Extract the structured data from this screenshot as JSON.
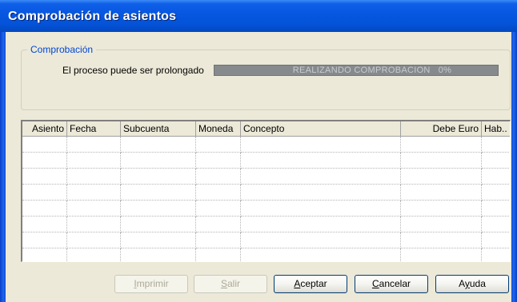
{
  "window": {
    "title": "Comprobación de asientos"
  },
  "group": {
    "legend": "Comprobación",
    "process_label": "El proceso puede ser prolongado",
    "progress_text": "REALIZANDO COMPROBACION   0%",
    "progress_percent": 0
  },
  "grid": {
    "columns": [
      "Asiento",
      "Fecha",
      "Subcuenta",
      "Moneda",
      "Concepto",
      "Debe Euro",
      "Hab.."
    ],
    "row_count": 8
  },
  "buttons": {
    "imprimir": {
      "first": "I",
      "rest": "mprimir",
      "enabled": false
    },
    "salir": {
      "first": "S",
      "rest": "alir",
      "enabled": false
    },
    "aceptar": {
      "first": "A",
      "rest": "ceptar",
      "enabled": true
    },
    "cancelar": {
      "first": "C",
      "rest": "ancelar",
      "enabled": true
    },
    "ayuda": {
      "pre": "A",
      "under": "y",
      "post": "uda",
      "enabled": true
    }
  },
  "colors": {
    "titlebar": "#0656e0",
    "legend": "#0046d5",
    "progress_bg": "#868a8c",
    "face": "#ece9d8"
  }
}
